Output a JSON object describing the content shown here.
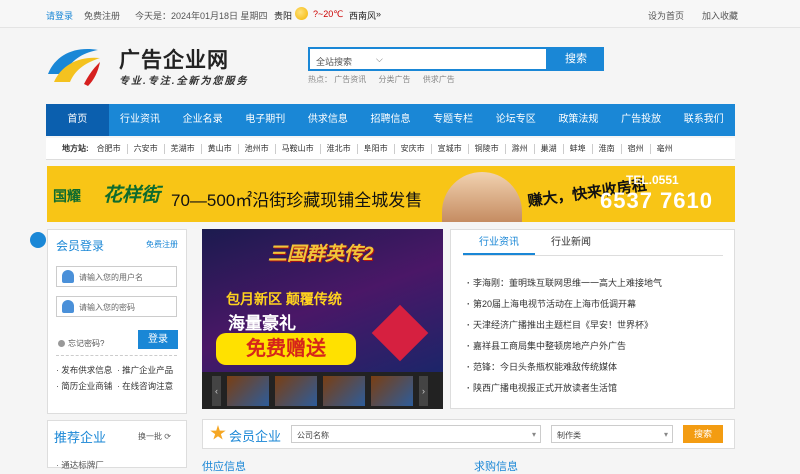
{
  "topbar": {
    "login": "请登录",
    "register": "免费注册",
    "date": "今天是：2024年01月18日 星期四",
    "city": "贵阳",
    "temp": "?~20℃",
    "wind": "西南风",
    "wind_arrow": "»",
    "set_home": "设为首页",
    "favorite": "加入收藏"
  },
  "header": {
    "site_name": "广告企业网",
    "slogan": "专业.专注.全新为您服务",
    "search_placeholder": "全站搜索",
    "search_button": "搜索",
    "hot_label": "热点：",
    "hot_items": [
      "广告资讯",
      "分类广告",
      "供求广告"
    ]
  },
  "nav": [
    "首页",
    "行业资讯",
    "企业名录",
    "电子期刊",
    "供求信息",
    "招聘信息",
    "专题专栏",
    "论坛专区",
    "政策法规",
    "广告投放",
    "联系我们"
  ],
  "cities": {
    "label": "地方站:",
    "items": [
      "合肥市",
      "六安市",
      "芜湖市",
      "黄山市",
      "池州市",
      "马鞍山市",
      "淮北市",
      "阜阳市",
      "安庆市",
      "宣城市",
      "铜陵市",
      "滁州",
      "巢湖",
      "蚌埠",
      "淮南",
      "宿州",
      "亳州"
    ]
  },
  "banner": {
    "brand": "国耀",
    "name": "花样街",
    "text": "70—500㎡沿街珍藏现铺全城发售",
    "slogan": "赚大，快来收房租",
    "tel_label": "TEL.0551",
    "tel": "6537 7610"
  },
  "login": {
    "title": "会员登录",
    "register": "免费注册",
    "user_placeholder": "请输入您的用户名",
    "pass_placeholder": "请输入您的密码",
    "forgot": "忘记密码?",
    "button": "登录",
    "links": [
      "发布供求信息",
      "推广企业产品",
      "简历企业商铺",
      "在线咨询注意"
    ]
  },
  "recommend": {
    "title": "推荐企业",
    "change": "换一批",
    "first": "通达标牌厂"
  },
  "game_ad": {
    "title": "三国群英传2",
    "line1": "包月新区 颠覆传统",
    "line2": "海量豪礼",
    "line3": "免费赠送"
  },
  "news": {
    "tabs": [
      "行业资讯",
      "行业新闻"
    ],
    "items": [
      "李海刚：董明珠互联网思维一一高大上难接地气",
      "第20届上海电视节活动在上海市低调开幕",
      "天津经济广播推出主题栏目《早安！世界杯》",
      "嘉祥县工商局集中整顿房地产户外广告",
      "范锋：今日头条瓶权能难敌传统媒体",
      "陕西广播电视报正式开放读者生活馆"
    ]
  },
  "member": {
    "title": "会员企业",
    "company_select": "公司名称",
    "type_select": "制作类",
    "search_button": "搜索"
  },
  "bottom": {
    "left": "供应信息",
    "right": "求购信息"
  }
}
